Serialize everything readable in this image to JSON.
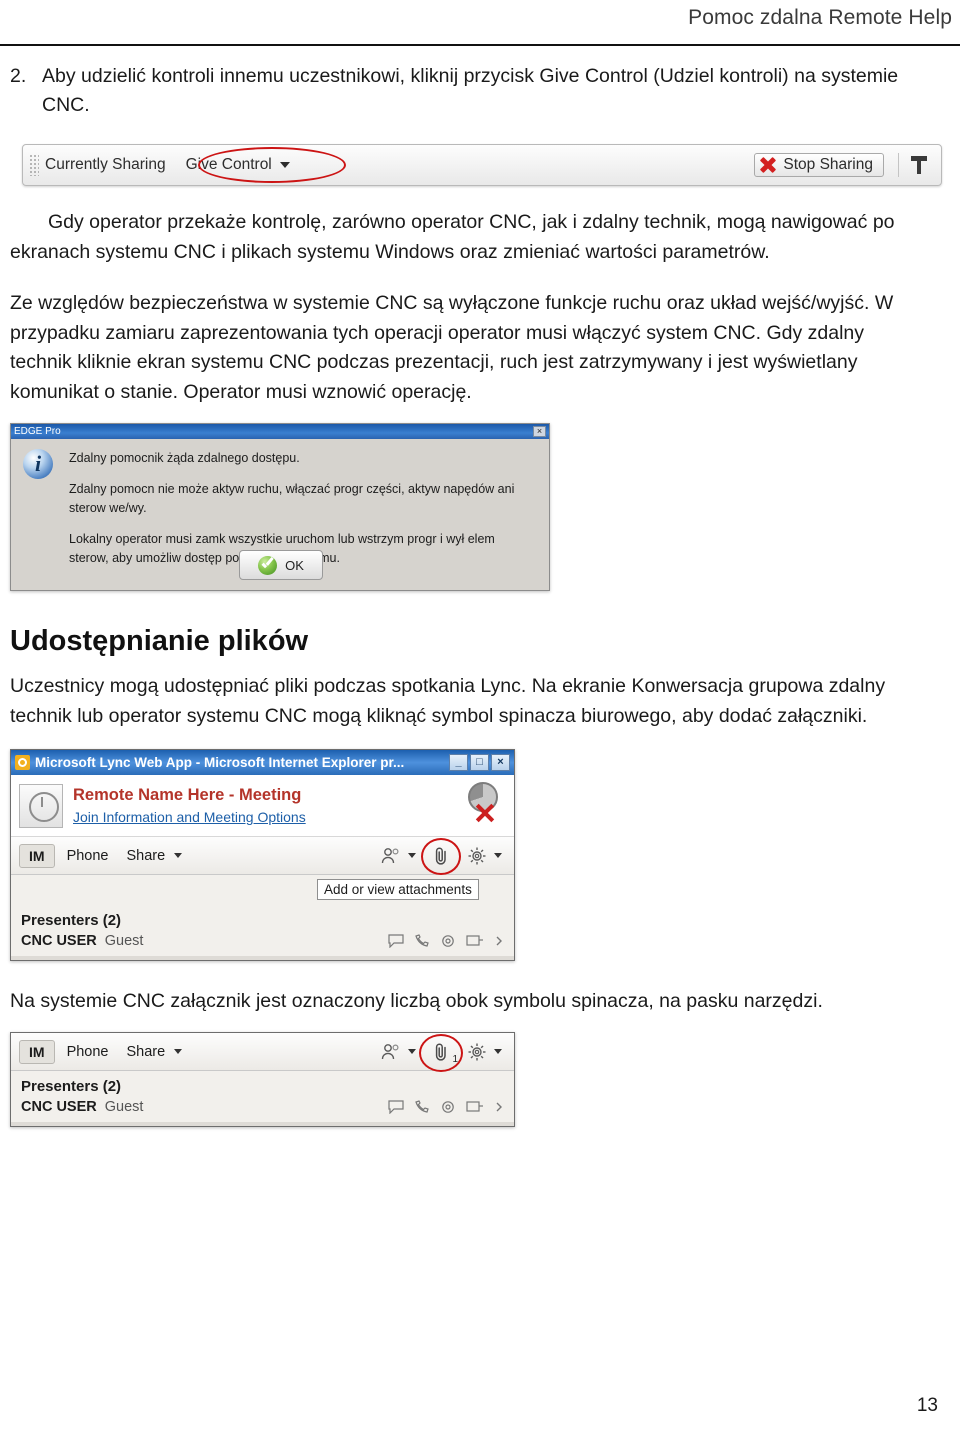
{
  "header": {
    "title": "Pomoc zdalna Remote Help"
  },
  "step": {
    "number": "2.",
    "text": "Aby udzielić kontroli innemu uczestnikowi, kliknij przycisk Give Control (Udziel kontroli) na systemie CNC."
  },
  "sharebar": {
    "currently_sharing": "Currently Sharing",
    "give_control": "Give Control",
    "stop_sharing": "Stop Sharing",
    "grip_icon": "drag-grip-icon",
    "caret_icon": "chevron-down-icon",
    "stop_icon": "red-x-icon",
    "pin_icon": "pin-icon",
    "annotation_color": "#cc1414"
  },
  "paragraphs": {
    "p1": "Gdy operator przekaże kontrolę, zarówno operator CNC, jak i zdalny technik, mogą nawigować po ekranach systemu CNC i plikach systemu Windows oraz zmieniać wartości parametrów.",
    "p2": "Ze względów bezpieczeństwa w systemie CNC są wyłączone funkcje ruchu oraz układ wejść/wyjść. W przypadku zamiaru zaprezentowania tych operacji operator musi włączyć system CNC. Gdy zdalny technik kliknie ekran systemu CNC podczas prezentacji, ruch jest zatrzymywany i jest wyświetlany komunikat o stanie. Operator musi wznowić operację."
  },
  "edge_dialog": {
    "title": "EDGE Pro",
    "close_label": "×",
    "info_icon": "info-icon",
    "line1": "Zdalny pomocnik żąda zdalnego dostępu.",
    "line2": "Zdalny pomocn nie może aktyw ruchu, włączać progr części, aktyw napędów ani sterow we/wy.",
    "line3": "Lokalny operator musi zamk wszystkie uruchom lub wstrzym progr i wył elem sterow, aby umożliw dostęp pomocnik zdalnemu.",
    "ok_label": "OK",
    "ok_icon": "green-check-icon"
  },
  "section": {
    "title": "Udostępnianie plików",
    "body": "Uczestnicy mogą udostępniać pliki podczas spotkania Lync. Na ekranie Konwersacja grupowa zdalny technik lub operator systemu CNC mogą kliknąć symbol spinacza biurowego, aby dodać załączniki."
  },
  "lync_window": {
    "title": "Microsoft Lync Web App - Microsoft Internet Explorer pr...",
    "logo_icon": "lync-logo-icon",
    "minimize_label": "_",
    "maximize_label": "□",
    "close_label": "×",
    "avatar_icon": "contact-photo-icon",
    "meeting_name": "Remote Name Here - Meeting",
    "meeting_link": "Join Information and Meeting Options",
    "pie_icon": "presentation-chart-icon",
    "close_share_icon": "red-x-icon",
    "toolbar": {
      "im": "IM",
      "phone": "Phone",
      "share": "Share",
      "people_icon": "people-icon",
      "attach_icon": "paperclip-icon",
      "gear_icon": "gear-icon",
      "caret_icon": "chevron-down-icon"
    },
    "tooltip": "Add or view attachments",
    "presenters_label": "Presenters (2)",
    "participant_name": "CNC USER",
    "participant_role": "Guest",
    "row_icons": [
      "chat-icon",
      "call-icon",
      "mute-icon",
      "share-icon",
      "more-icon"
    ]
  },
  "caption_after_lync": "Na systemie CNC załącznik jest oznaczony liczbą obok symbolu spinacza, na pasku narzędzi.",
  "lync_toolbar_2": {
    "im": "IM",
    "phone": "Phone",
    "share": "Share",
    "attach_count": "1",
    "presenters_label": "Presenters (2)",
    "participant_name": "CNC USER",
    "participant_role": "Guest"
  },
  "footer": {
    "page_number": "13"
  }
}
